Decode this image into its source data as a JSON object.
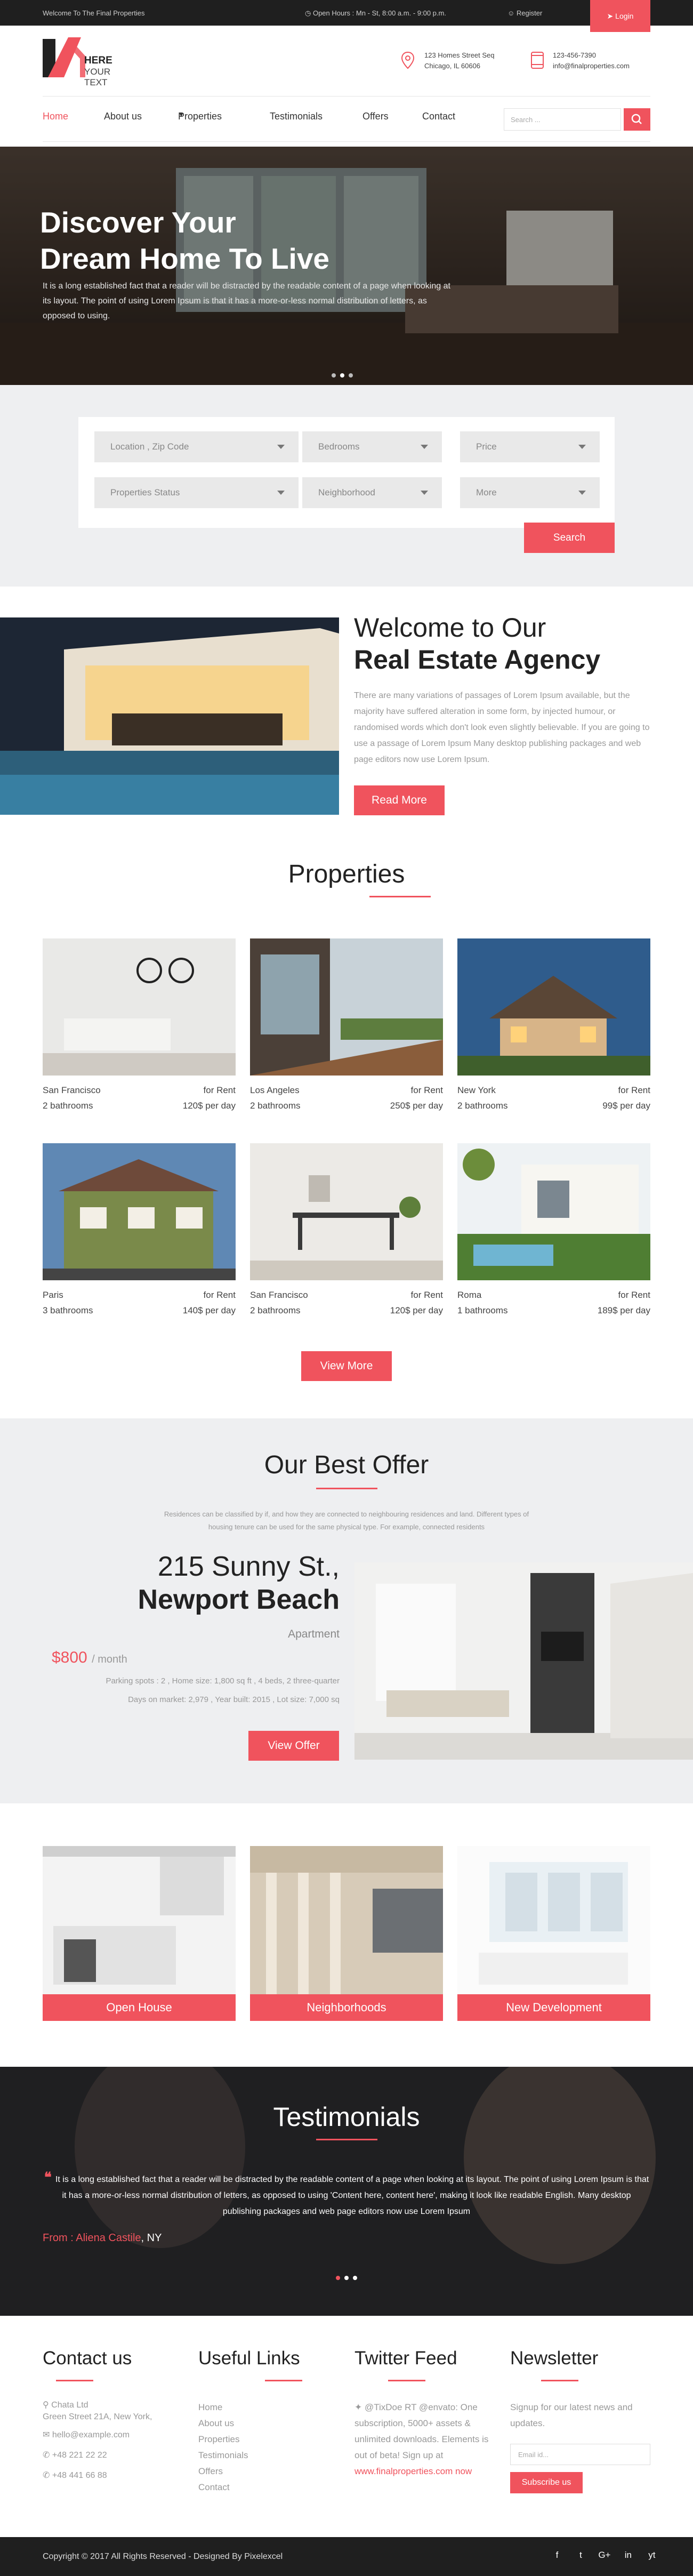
{
  "topbar": {
    "welcome": "Welcome To The Final Properties",
    "hours": "Open Hours : Mn - St, 8:00 a.m. - 9:00 p.m.",
    "register": "Register",
    "login": "Login"
  },
  "logo": {
    "line1": "HERE",
    "line2": "YOUR TEXT"
  },
  "contact": {
    "address_line1": "123 Homes Street Seq",
    "address_line2": "Chicago, IL 60606",
    "phone": "123-456-7390",
    "email": "info@finalproperties.com"
  },
  "nav": {
    "items": [
      "Home",
      "About us",
      "Properties",
      "Testimonials",
      "Offers",
      "Contact"
    ],
    "search_placeholder": "Search ..."
  },
  "hero": {
    "title_line1": "Discover Your",
    "title_line2": "Dream Home To Live",
    "text": "It is a long established fact that a reader will be distracted by the readable content of a page when looking at its layout. The point of using Lorem Ipsum is that it has a more-or-less normal distribution of letters, as opposed to using."
  },
  "search_form": {
    "fields": [
      "Location , Zip Code",
      "Bedrooms",
      "Price",
      "Properties Status",
      "Neighborhood",
      "More"
    ],
    "button": "Search"
  },
  "welcome": {
    "title_line1": "Welcome to Our",
    "title_line2": "Real Estate Agency",
    "text": "There are many variations of passages of Lorem Ipsum available, but the majority have suffered alteration in some form, by injected humour, or randomised words which don't look even slightly believable. If you are going to use a passage of Lorem Ipsum Many desktop publishing packages and web page editors now use Lorem Ipsum.",
    "button": "Read More"
  },
  "properties": {
    "title": "Properties",
    "items": [
      {
        "city": "San Francisco",
        "status": "for Rent",
        "baths": "2 bathrooms",
        "price": "120$ per day"
      },
      {
        "city": "Los Angeles",
        "status": "for Rent",
        "baths": "2 bathrooms",
        "price": "250$ per day"
      },
      {
        "city": "New York",
        "status": "for Rent",
        "baths": "2 bathrooms",
        "price": "99$ per day"
      },
      {
        "city": "Paris",
        "status": "for Rent",
        "baths": "3 bathrooms",
        "price": "140$ per day"
      },
      {
        "city": "San Francisco",
        "status": "for Rent",
        "baths": "2 bathrooms",
        "price": "120$ per day"
      },
      {
        "city": "Roma",
        "status": "for Rent",
        "baths": "1 bathrooms",
        "price": "189$ per day"
      }
    ],
    "button": "View More"
  },
  "offer": {
    "title": "Our Best Offer",
    "desc": "Residences can be classified by if, and how they are connected to neighbouring residences and land. Different types of housing tenure can be used for the same physical type. For example, connected residents",
    "street": "215 Sunny St.,",
    "city": "Newport Beach",
    "type": "Apartment",
    "price": "$800",
    "per": "/ month",
    "meta1": "Parking spots : 2   , Home size: 1,800 sq ft   , 4 beds, 2 three-quarter",
    "meta2": "Days on market: 2,979   , Year built: 2015   , Lot size: 7,000 sq",
    "button": "View Offer"
  },
  "categories": [
    "Open House",
    "Neighborhoods",
    "New Development"
  ],
  "testimonials": {
    "title": "Testimonials",
    "quote": "It is a long established fact that a reader will be distracted by the readable content of a page when looking at its layout. The point of using Lorem Ipsum is that it has a more-or-less normal distribution of letters, as opposed to using 'Content here, content here', making it look like readable English. Many desktop publishing packages and web page editors now use Lorem Ipsum",
    "from_label": "From : Aliena Castile",
    "from_place": ", NY"
  },
  "footer": {
    "contact_title": "Contact us",
    "contact_lines": [
      "Chata Ltd",
      "Green Street 21A, New York,",
      "hello@example.com",
      "+48 221 22 22",
      "+48 441 66 88"
    ],
    "links_title": "Useful Links",
    "links": [
      "Home",
      "About us",
      "Properties",
      "Testimonials",
      "Offers",
      "Contact"
    ],
    "twitter_title": "Twitter Feed",
    "twitter_text": "@TixDoe RT @envato: One subscription, 5000+ assets & unlimited downloads. Elements is out of beta! Sign up at",
    "twitter_link": "www.finalproperties.com",
    "twitter_tail": "now",
    "news_title": "Newsletter",
    "news_text": "Signup for our latest news and updates.",
    "news_placeholder": "Email id...",
    "news_button": "Subscribe us"
  },
  "bottom": {
    "copyright": "Copyright © 2017 All Rights Reserved - Designed By Pixelexcel",
    "social": [
      "f",
      "t",
      "G+",
      "in",
      "yt"
    ]
  },
  "colors": {
    "accent": "#f0535d",
    "dark": "#1f1f1f",
    "light_bg": "#eeeff1"
  }
}
